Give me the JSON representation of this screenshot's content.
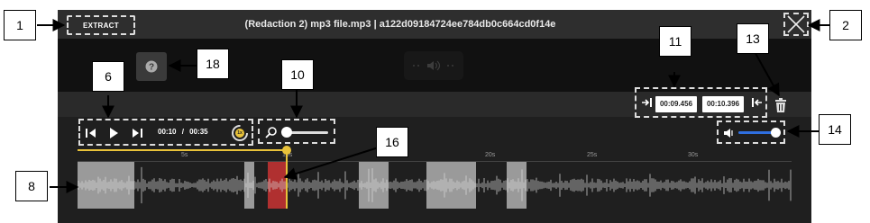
{
  "window": {
    "title": "(Redaction 2) mp3 file.mp3 | a122d09184724ee784db0c664cd0f14e",
    "extract_label": "EXTRACT"
  },
  "trim": {
    "start_time": "00:09.456",
    "end_time": "00:10.396"
  },
  "transport": {
    "current_time": "00:10",
    "separator": "/",
    "total_time": "00:35",
    "speed_label": "1x"
  },
  "zoom": {
    "level": 0.0
  },
  "volume": {
    "level": 1.0
  },
  "timeline": {
    "ticks": [
      "5s",
      "10s",
      "15s",
      "20s",
      "25s",
      "30s"
    ],
    "progress": 0.29
  },
  "colors": {
    "accent_yellow": "#e8c23a",
    "volume_blue": "#2f6fe0",
    "redaction_red": "#b03030",
    "segment_gray": "#9a9a9a"
  },
  "icons": {
    "close": "close-icon",
    "help": "help-icon",
    "volume": "volume-icon",
    "trash": "trash-icon",
    "zoom": "magnifier-icon"
  },
  "callouts": [
    "1",
    "2",
    "6",
    "8",
    "10",
    "11",
    "13",
    "14",
    "16",
    "18"
  ]
}
